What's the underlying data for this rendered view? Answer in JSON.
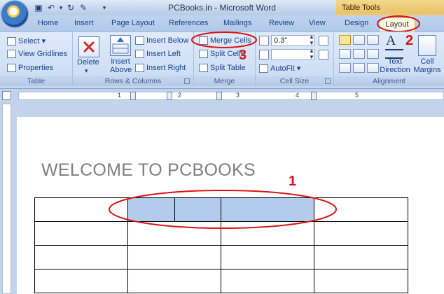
{
  "window": {
    "title": "PCBooks.in - Microsoft Word",
    "contextual_tab_group": "Table Tools"
  },
  "tabs": [
    "Home",
    "Insert",
    "Page Layout",
    "References",
    "Mailings",
    "Review",
    "View",
    "Design",
    "Layout"
  ],
  "active_tab": "Layout",
  "ribbon": {
    "table": {
      "label": "Table",
      "select": "Select",
      "view_gridlines": "View Gridlines",
      "properties": "Properties"
    },
    "rows_columns": {
      "label": "Rows & Columns",
      "delete": "Delete",
      "insert_above_1": "Insert",
      "insert_above_2": "Above",
      "insert_below": "Insert Below",
      "insert_left": "Insert Left",
      "insert_right": "Insert Right"
    },
    "merge": {
      "label": "Merge",
      "merge_cells": "Merge Cells",
      "split_cells": "Split Cells",
      "split_table": "Split Table"
    },
    "cell_size": {
      "label": "Cell Size",
      "height_value": "0.3\"",
      "autofit": "AutoFit"
    },
    "alignment": {
      "label": "Alignment",
      "text_direction_1": "Text",
      "text_direction_2": "Direction",
      "cell_margins_1": "Cell",
      "cell_margins_2": "Margins"
    }
  },
  "ruler": {
    "numbers": [
      "1",
      "2",
      "3",
      "4",
      "5"
    ]
  },
  "document": {
    "heading": "WELCOME TO PCBOOKS"
  },
  "annotations": {
    "step1": "1",
    "step2": "2",
    "step3": "3"
  },
  "colors": {
    "annotation": "#d81414",
    "selected_cells": "#b5cbed",
    "contextual_tab": "#e9c46a"
  }
}
